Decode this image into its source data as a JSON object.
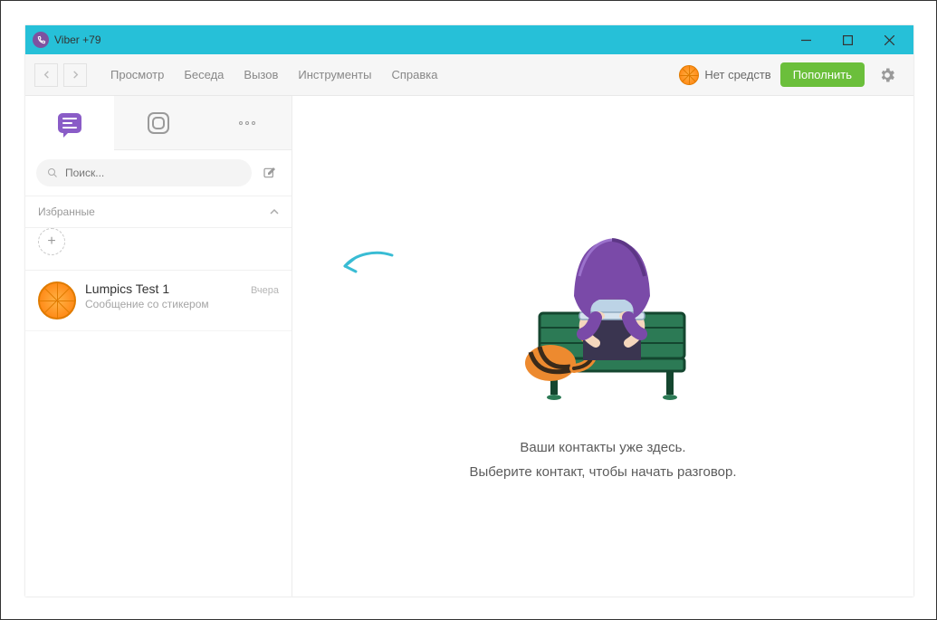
{
  "titlebar": {
    "title": "Viber +79"
  },
  "menu": {
    "items": [
      "Просмотр",
      "Беседа",
      "Вызов",
      "Инструменты",
      "Справка"
    ],
    "balance_label": "Нет средств",
    "topup_label": "Пополнить"
  },
  "sidebar": {
    "search_placeholder": "Поиск...",
    "favorites_label": "Избранные",
    "chats": [
      {
        "name": "Lumpics Test 1",
        "preview": "Сообщение со стикером",
        "time": "Вчера"
      }
    ]
  },
  "empty_state": {
    "line1": "Ваши контакты уже здесь.",
    "line2": "Выберите контакт, чтобы начать разговор."
  },
  "colors": {
    "accent_purple": "#8a5cc7",
    "titlebar_teal": "#26c0d8",
    "button_green": "#6bbf3b",
    "orange": "#ff8c1a"
  }
}
